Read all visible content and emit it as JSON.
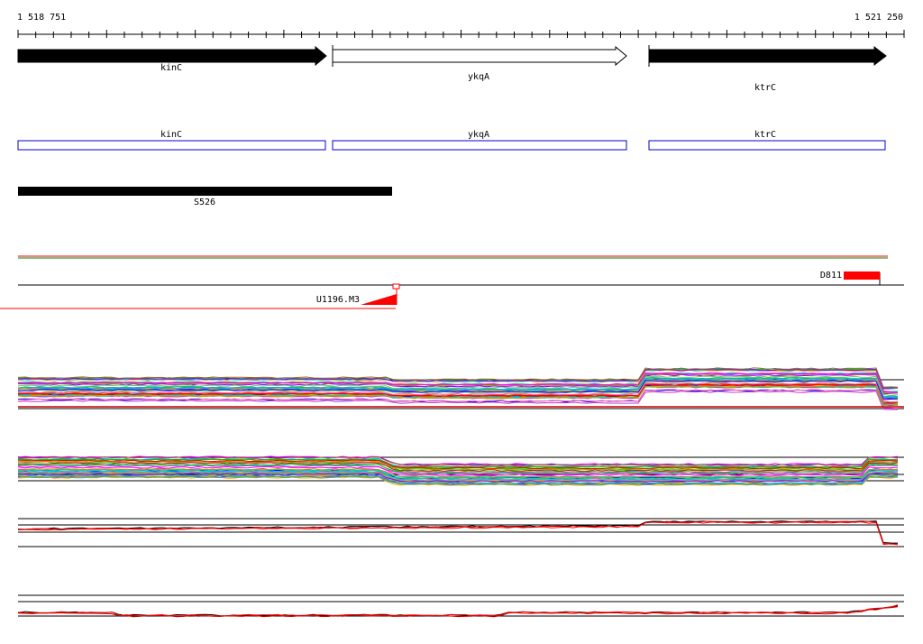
{
  "ruler": {
    "start_label": "1 518 751",
    "end_label": "1 521 250"
  },
  "genes": [
    {
      "name": "kinC",
      "strand": "+",
      "filled": true
    },
    {
      "name": "ykqA",
      "strand": "+",
      "filled": false
    },
    {
      "name": "ktrC",
      "strand": "+",
      "filled": true
    }
  ],
  "annotated_genes": [
    {
      "name": "kinC"
    },
    {
      "name": "ykqA"
    },
    {
      "name": "ktrC"
    }
  ],
  "segments": [
    {
      "name": "S526"
    }
  ],
  "features": {
    "downstream_label": "D811",
    "upstream_label": "U1196.M3"
  },
  "colors": {
    "gene_fill": "#000000",
    "gene_outline_box": "#0000cc",
    "feature": "#ff0000",
    "track_line": "#000000"
  }
}
